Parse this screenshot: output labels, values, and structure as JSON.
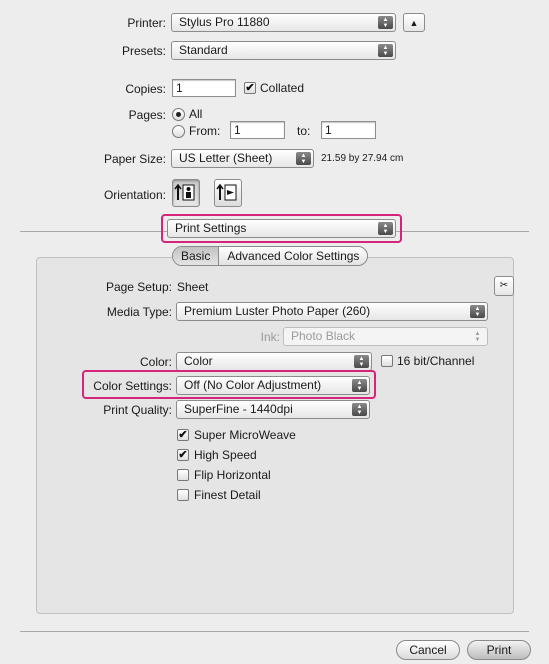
{
  "printer": {
    "label": "Printer:",
    "value": "Stylus Pro 11880"
  },
  "presets": {
    "label": "Presets:",
    "value": "Standard"
  },
  "copies": {
    "label": "Copies:",
    "value": "1",
    "collated_label": "Collated",
    "collated_checked": true
  },
  "pages": {
    "label": "Pages:",
    "all_label": "All",
    "from_label": "From:",
    "from_value": "1",
    "to_label": "to:",
    "to_value": "1"
  },
  "paper_size": {
    "label": "Paper Size:",
    "value": "US Letter (Sheet)",
    "dimensions": "21.59 by 27.94 cm"
  },
  "orientation": {
    "label": "Orientation:"
  },
  "panel_popup": {
    "value": "Print Settings"
  },
  "tabs": {
    "basic": "Basic",
    "advanced": "Advanced Color Settings"
  },
  "page_setup": {
    "label": "Page Setup:",
    "value": "Sheet"
  },
  "media_type": {
    "label": "Media Type:",
    "value": "Premium Luster Photo Paper (260)"
  },
  "ink": {
    "label": "Ink:",
    "value": "Photo Black"
  },
  "color": {
    "label": "Color:",
    "value": "Color",
    "bit_label": "16 bit/Channel"
  },
  "color_settings": {
    "label": "Color Settings:",
    "value": "Off (No Color Adjustment)"
  },
  "print_quality": {
    "label": "Print Quality:",
    "value": "SuperFine - 1440dpi"
  },
  "options": [
    {
      "label": "Super MicroWeave",
      "checked": true
    },
    {
      "label": "High Speed",
      "checked": true
    },
    {
      "label": "Flip Horizontal",
      "checked": false
    },
    {
      "label": "Finest Detail",
      "checked": false
    }
  ],
  "buttons": {
    "cancel": "Cancel",
    "print": "Print"
  },
  "colors": {
    "highlight": "#d6247a",
    "background": "#ededed"
  }
}
